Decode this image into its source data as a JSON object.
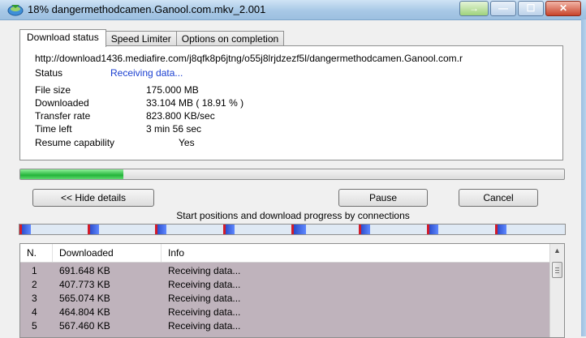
{
  "window": {
    "title": "18% dangermethodcamen.Ganool.com.mkv_2.001",
    "icon": "idm-globe-icon",
    "controls": {
      "extra": "→",
      "minimize": "—",
      "maximize": "☐",
      "close": "✕"
    }
  },
  "tabs": [
    {
      "label": "Download status",
      "active": true
    },
    {
      "label": "Speed Limiter",
      "active": false
    },
    {
      "label": "Options on completion",
      "active": false
    }
  ],
  "status": {
    "url": "http://download1436.mediafire.com/j8qfk8p6jtng/o55j8lrjdzezf5l/dangermethodcamen.Ganool.com.r",
    "status_label": "Status",
    "status_value": "Receiving data...",
    "file_size_label": "File size",
    "file_size_value": "175.000  MB",
    "downloaded_label": "Downloaded",
    "downloaded_value": "33.104  MB  ( 18.91 % )",
    "transfer_rate_label": "Transfer rate",
    "transfer_rate_value": "823.800  KB/sec",
    "time_left_label": "Time left",
    "time_left_value": "3 min 56 sec",
    "resume_label": "Resume capability",
    "resume_value": "Yes"
  },
  "progress": {
    "fraction": 0.1891,
    "color": "#23b43a"
  },
  "buttons": {
    "hide_details": "<< Hide details",
    "pause": "Pause",
    "cancel": "Cancel"
  },
  "connections": {
    "caption": "Start positions and download progress by connections",
    "segment_color": "#1f3fbf",
    "marker_color": "#d21b2a"
  },
  "list": {
    "columns": [
      "N.",
      "Downloaded",
      "Info"
    ],
    "rows": [
      {
        "n": "1",
        "downloaded": "691.648  KB",
        "info": "Receiving data..."
      },
      {
        "n": "2",
        "downloaded": "407.773  KB",
        "info": "Receiving data..."
      },
      {
        "n": "3",
        "downloaded": "565.074  KB",
        "info": "Receiving data..."
      },
      {
        "n": "4",
        "downloaded": "464.804  KB",
        "info": "Receiving data..."
      },
      {
        "n": "5",
        "downloaded": "567.460  KB",
        "info": "Receiving data..."
      }
    ]
  }
}
